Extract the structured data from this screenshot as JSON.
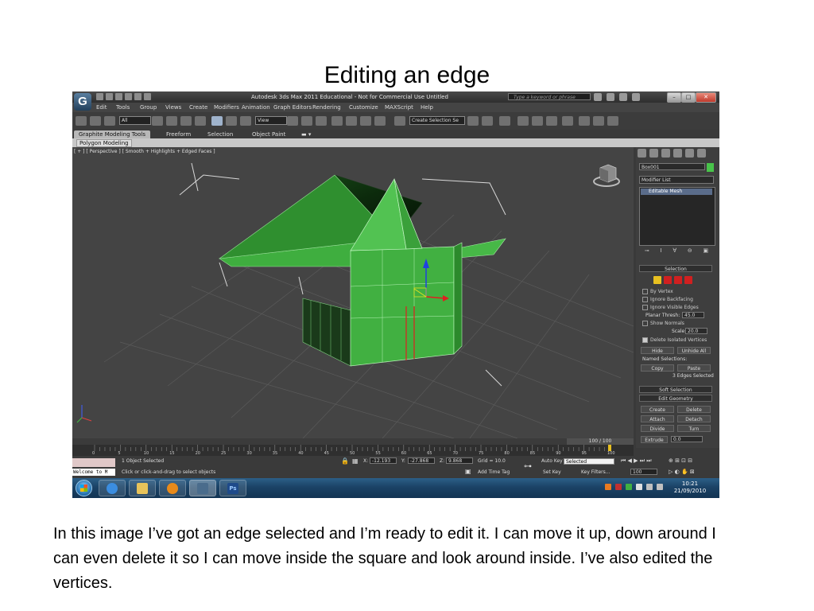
{
  "slide": {
    "title": "Editing an edge",
    "caption": "In this image I’ve got an edge selected and I’m ready to edit it. I can move it up, down around I can even delete it so I can move inside the square and look around inside. I’ve also edited the vertices."
  },
  "app": {
    "logo": "G",
    "window_title": "Autodesk 3ds Max 2011   Educational - Not for Commercial Use   Untitled",
    "search_placeholder": "Type a keyword or phrase",
    "menu": [
      "Edit",
      "Tools",
      "Group",
      "Views",
      "Create",
      "Modifiers",
      "Animation",
      "Graph Editors",
      "Rendering",
      "Customize",
      "MAXScript",
      "Help"
    ],
    "toolbar": {
      "selection_filter": "All",
      "ref_coord": "View",
      "named_selection": "Create Selection Se"
    },
    "ribbon_tabs": [
      "Graphite Modeling Tools",
      "Freeform",
      "Selection",
      "Object Paint"
    ],
    "ribbon_sub_tab": "Polygon Modeling",
    "viewport_label": "[ + ] [ Perspective ] [ Smooth + Highlights + Edged Faces ]",
    "command_panel": {
      "object_name": "Box001",
      "object_color": "#48c34a",
      "modifier_list": "Modifier List",
      "stack_item": "Editable Mesh",
      "selection_rollout": "Selection",
      "checkboxes": [
        "By Vertex",
        "Ignore Backfacing",
        "Ignore Visible Edges"
      ],
      "planar_thresh_label": "Planar Thresh:",
      "planar_thresh_value": "45.0",
      "show_normals": "Show Normals",
      "scale_label": "Scale:",
      "scale_value": "20.0",
      "delete_isolated": "Delete Isolated Vertices",
      "hide_button": "Hide",
      "unhide_all_button": "Unhide All",
      "named_selections": "Named Selections:",
      "copy_button": "Copy",
      "paste_button": "Paste",
      "selection_status": "3 Edges Selected",
      "soft_selection": "Soft Selection",
      "edit_geometry": "Edit Geometry",
      "create_button": "Create",
      "delete_button": "Delete",
      "attach_button": "Attach",
      "detach_button": "Detach",
      "divide_button": "Divide",
      "turn_button": "Turn",
      "extrude_button": "Extrude",
      "extrude_value": "0.0"
    },
    "timeline": {
      "frame_label": "100 / 100",
      "ticks": [
        "0",
        "5",
        "10",
        "15",
        "20",
        "25",
        "30",
        "35",
        "40",
        "45",
        "50",
        "55",
        "60",
        "65",
        "70",
        "75",
        "80",
        "85",
        "90",
        "95",
        "100"
      ]
    },
    "status": {
      "listener_text": "Welcome to M",
      "selection_text": "1 Object Selected",
      "prompt_text": "Click or click-and-drag to select objects",
      "x_label": "X:",
      "x_value": "-12.193",
      "y_label": "Y:",
      "y_value": "-27.868",
      "z_label": "Z:",
      "z_value": "9.868",
      "grid": "Grid = 10.0",
      "add_time_tag": "Add Time Tag",
      "auto_key": "Auto Key",
      "set_key": "Set Key",
      "selected_dropdown": "Selected",
      "key_filters": "Key Filters...",
      "current_frame": "100"
    },
    "taskbar": {
      "clock_time": "10:21",
      "clock_date": "21/09/2010",
      "ps_label": "Ps"
    }
  }
}
